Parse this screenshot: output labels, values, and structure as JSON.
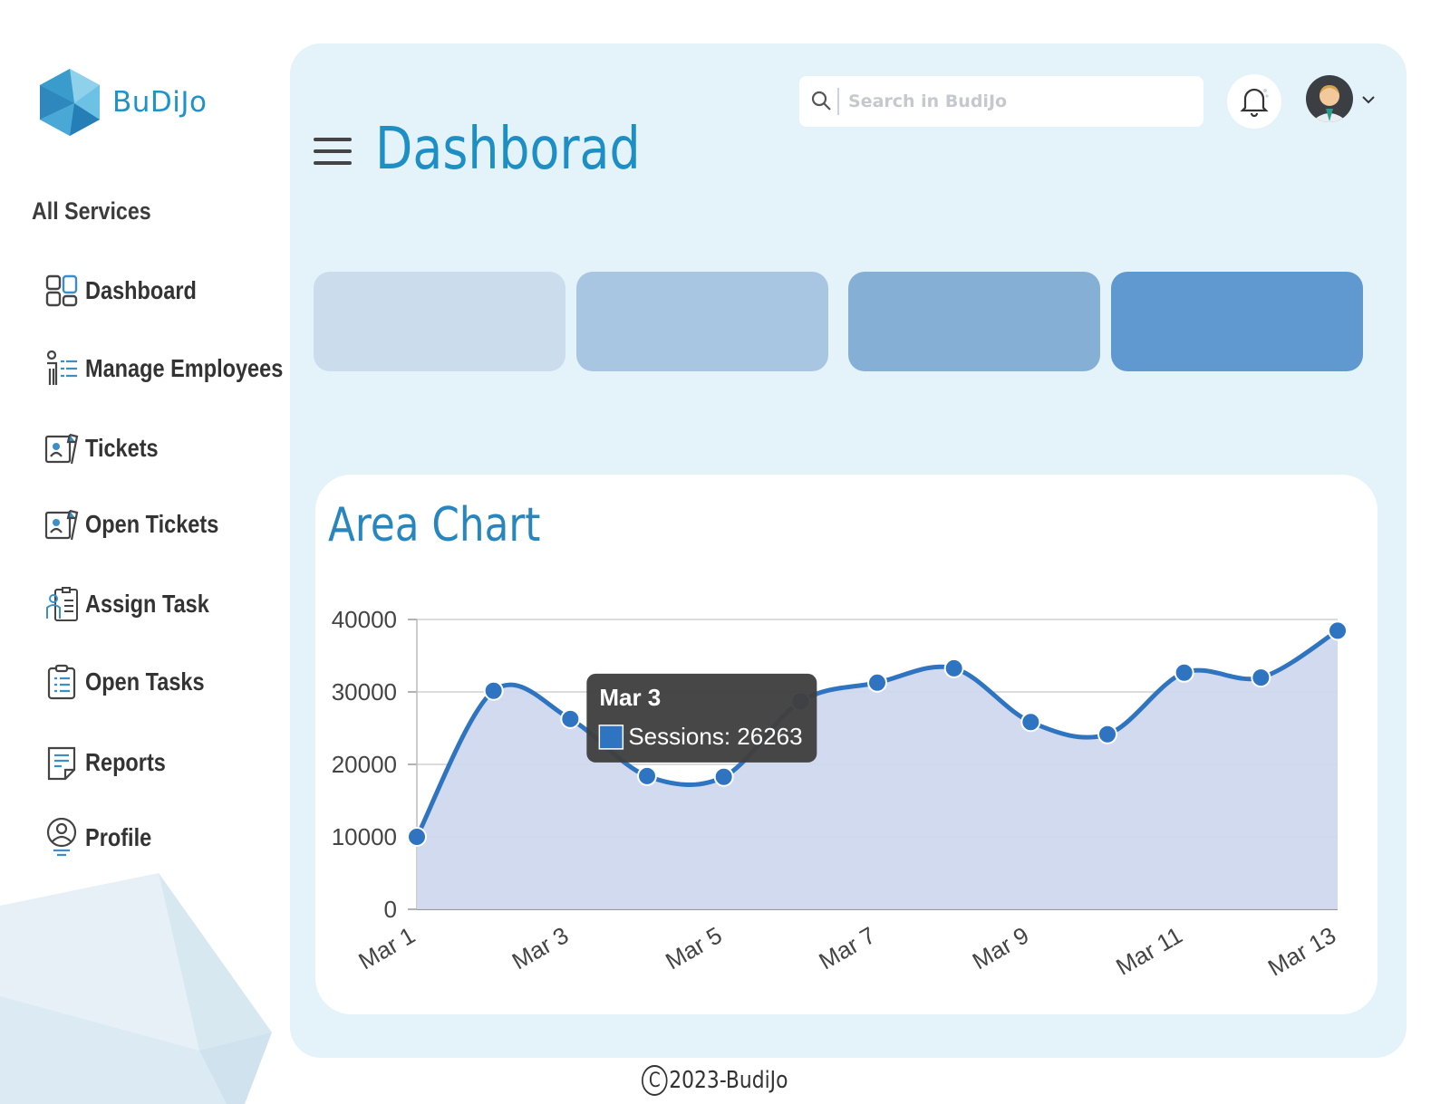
{
  "app": {
    "logo_text": "BuDiJo",
    "footer_year_text": "2023-BudiJo",
    "copyright_symbol": "C"
  },
  "sidebar": {
    "section_title": "All Services",
    "items": [
      {
        "label": "Dashboard",
        "icon": "dashboard-icon"
      },
      {
        "label": "Manage Employees",
        "icon": "employees-icon"
      },
      {
        "label": "Tickets",
        "icon": "ticket-icon"
      },
      {
        "label": "Open Tickets",
        "icon": "ticket-icon"
      },
      {
        "label": "Assign Task",
        "icon": "assign-task-icon"
      },
      {
        "label": "Open Tasks",
        "icon": "clipboard-icon"
      },
      {
        "label": "Reports",
        "icon": "report-icon"
      },
      {
        "label": "Profile",
        "icon": "profile-icon"
      }
    ]
  },
  "header": {
    "title": "Dashborad",
    "search_placeholder": "Search in BudiJo"
  },
  "stat_cards": [
    {
      "color": "#cbddec"
    },
    {
      "color": "#a8c6e2"
    },
    {
      "color": "#86afd6"
    },
    {
      "color": "#5f99cf"
    }
  ],
  "colors": {
    "accent": "#1e8fc4",
    "series_line": "#2f74c0",
    "series_fill": "#d0d8ee"
  },
  "chart_data": {
    "type": "area",
    "title": "Area Chart",
    "x": [
      "Mar 1",
      "Mar 2",
      "Mar 3",
      "Mar 4",
      "Mar 5",
      "Mar 6",
      "Mar 7",
      "Mar 8",
      "Mar 9",
      "Mar 10",
      "Mar 11",
      "Mar 12",
      "Mar 13"
    ],
    "x_tick_labels": [
      "Mar 1",
      "Mar 3",
      "Mar 5",
      "Mar 7",
      "Mar 9",
      "Mar 11",
      "Mar 13"
    ],
    "y_ticks": [
      0,
      10000,
      20000,
      30000,
      40000
    ],
    "ylim": [
      0,
      40000
    ],
    "series": [
      {
        "name": "Sessions",
        "values": [
          10000,
          30162,
          26263,
          18394,
          18287,
          28682,
          31274,
          33259,
          25849,
          24159,
          32651,
          31984,
          38451
        ]
      }
    ],
    "grid": true,
    "tooltip": {
      "title": "Mar 3",
      "label": "Sessions: 26263"
    }
  }
}
